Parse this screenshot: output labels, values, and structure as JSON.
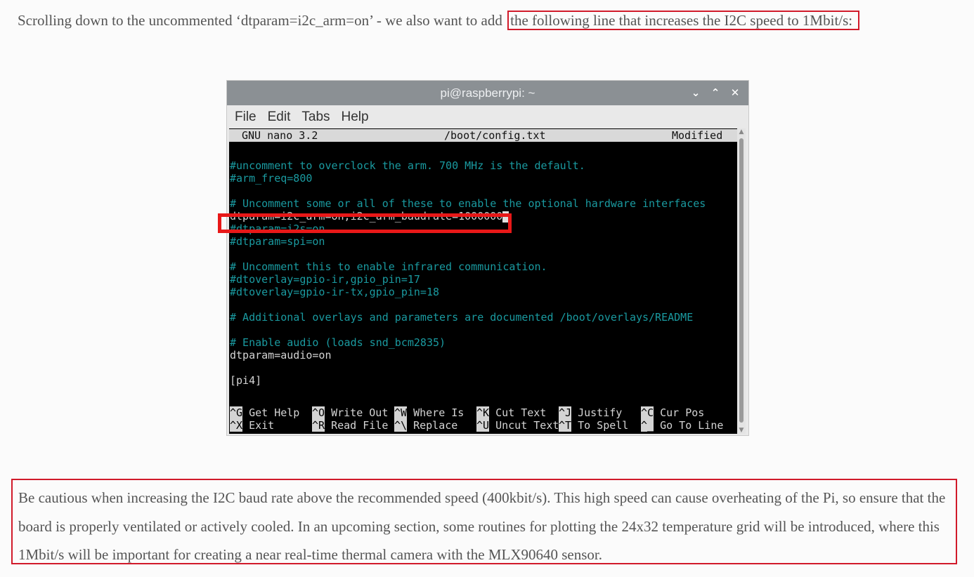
{
  "intro": {
    "before": "Scrolling down to the uncommented ‘dtparam=i2c_arm=on’ - we also want to add ",
    "highlight": "the following line that increases the I2C speed to 1Mbit/s:"
  },
  "terminal": {
    "title": "pi@raspberrypi: ~",
    "controls": [
      "⌄",
      "⌃",
      "✕"
    ],
    "menu": [
      "File",
      "Edit",
      "Tabs",
      "Help"
    ],
    "nano": {
      "version": "GNU nano 3.2",
      "file": "/boot/config.txt",
      "status": "Modified"
    },
    "lines": [
      "#uncomment to overclock the arm. 700 MHz is the default.",
      "#arm_freq=800",
      "",
      "# Uncomment some or all of these to enable the optional hardware interfaces",
      "dtparam=i2c_arm=on,i2c_arm_baudrate=1000000",
      "#dtparam=i2s=on",
      "#dtparam=spi=on",
      "",
      "# Uncomment this to enable infrared communication.",
      "#dtoverlay=gpio-ir,gpio_pin=17",
      "#dtoverlay=gpio-ir-tx,gpio_pin=18",
      "",
      "# Additional overlays and parameters are documented /boot/overlays/README",
      "",
      "# Enable audio (loads snd_bcm2835)",
      "dtparam=audio=on",
      "",
      "[pi4]"
    ],
    "shortcuts_row1": [
      {
        "key": "^G",
        "label": " Get Help"
      },
      {
        "key": "^O",
        "label": " Write Out"
      },
      {
        "key": "^W",
        "label": " Where Is"
      },
      {
        "key": "^K",
        "label": " Cut Text"
      },
      {
        "key": "^J",
        "label": " Justify"
      },
      {
        "key": "^C",
        "label": " Cur Pos"
      }
    ],
    "shortcuts_row2": [
      {
        "key": "^X",
        "label": " Exit"
      },
      {
        "key": "^R",
        "label": " Read File"
      },
      {
        "key": "^\\",
        "label": " Replace"
      },
      {
        "key": "^U",
        "label": " Uncut Text"
      },
      {
        "key": "^T",
        "label": " To Spell"
      },
      {
        "key": "^_",
        "label": " Go To Line"
      }
    ]
  },
  "caution": "Be cautious when increasing the I2C baud rate above the recommended speed (400kbit/s). This high speed can cause overheating of the Pi, so ensure that the board is properly ventilated or actively cooled. In an upcoming section, some routines for plotting the 24x32 temperature grid will be introduced, where this 1Mbit/s will be important for creating a near real-time thermal camera with the MLX90640 sensor."
}
